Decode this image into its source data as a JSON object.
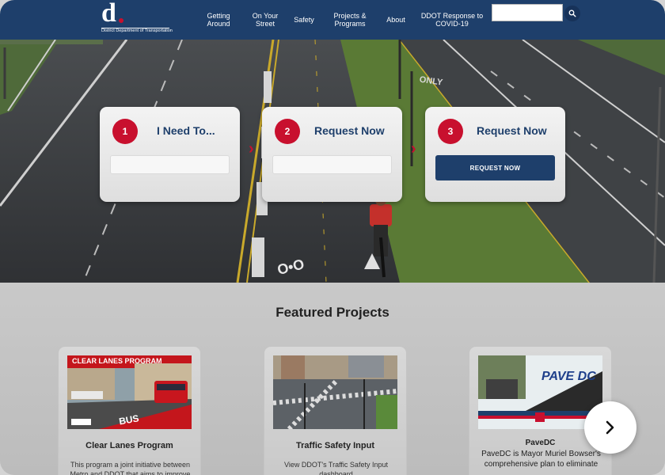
{
  "header": {
    "logo_letter": "d",
    "logo_text": "District Department of Transportation",
    "nav": [
      {
        "line1": "Getting",
        "line2": "Around"
      },
      {
        "line1": "On Your",
        "line2": "Street"
      },
      {
        "line1": "Safety",
        "line2": ""
      },
      {
        "line1": "Projects &",
        "line2": "Programs"
      },
      {
        "line1": "About",
        "line2": ""
      },
      {
        "line1": "DDOT Response to",
        "line2": "COVID-19"
      }
    ],
    "search_value": "",
    "search_icon": "search-icon"
  },
  "steps": [
    {
      "number": "1",
      "title": "I Need To..."
    },
    {
      "number": "2",
      "title": "Request Now"
    },
    {
      "number": "3",
      "title": "Request Now",
      "button": "REQUEST NOW"
    }
  ],
  "featured": {
    "title": "Featured Projects",
    "projects": [
      {
        "image_text": "CLEAR LANES PROGRAM",
        "title": "Clear Lanes Program",
        "desc": "This program a joint initiative between Metro and DDOT that aims to improve"
      },
      {
        "image_text": "",
        "title": "Traffic Safety Input",
        "desc": "View DDOT's Traffic Safety Input dashboard"
      },
      {
        "image_text": "PAVE DC",
        "title": "PaveDC",
        "desc": "PaveDC is Mayor Muriel Bowser's comprehensive plan to eliminate"
      }
    ]
  },
  "colors": {
    "navy": "#1e3f6b",
    "red": "#c8102e"
  },
  "next_icon": "chevron-right-icon"
}
